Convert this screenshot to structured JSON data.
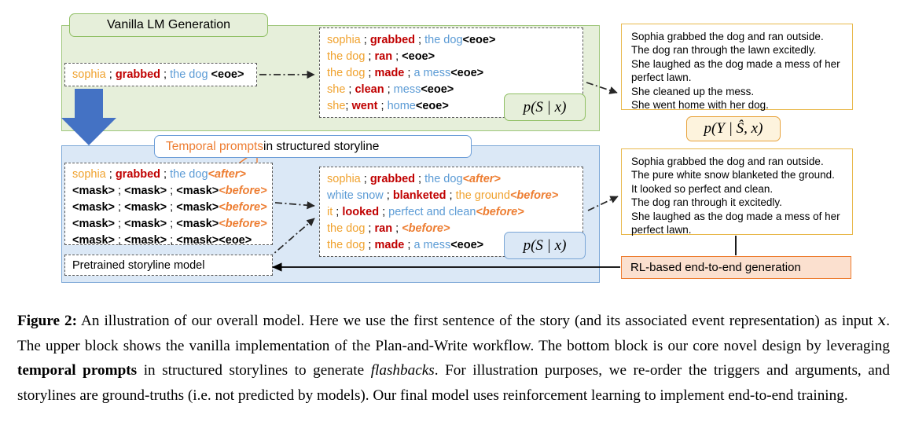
{
  "figure": {
    "vanilla_header": "Vanilla LM Generation",
    "temporal_header": {
      "accent": "Temporal prompts",
      "rest": " in structured storyline"
    },
    "input_box": [
      {
        "t": "sophia",
        "c": "ent"
      },
      {
        "t": " ; ",
        "c": "sep"
      },
      {
        "t": "grabbed",
        "c": "verb"
      },
      {
        "t": " ; ",
        "c": "sep"
      },
      {
        "t": "the dog",
        "c": "obj"
      },
      {
        "t": " <eoe>",
        "c": "tag"
      }
    ],
    "top_storyline": [
      [
        {
          "t": "sophia",
          "c": "ent"
        },
        {
          "t": " ; ",
          "c": "sep"
        },
        {
          "t": "grabbed",
          "c": "verb"
        },
        {
          "t": " ; ",
          "c": "sep"
        },
        {
          "t": "the dog",
          "c": "obj"
        },
        {
          "t": "<eoe>",
          "c": "tag"
        }
      ],
      [
        {
          "t": "the dog",
          "c": "ent"
        },
        {
          "t": " ; ",
          "c": "sep"
        },
        {
          "t": "ran",
          "c": "verb"
        },
        {
          "t": " ; ",
          "c": "sep"
        },
        {
          "t": "<eoe>",
          "c": "tag"
        }
      ],
      [
        {
          "t": "the dog",
          "c": "ent"
        },
        {
          "t": " ; ",
          "c": "sep"
        },
        {
          "t": "made",
          "c": "verb"
        },
        {
          "t": " ; ",
          "c": "sep"
        },
        {
          "t": "a mess",
          "c": "obj"
        },
        {
          "t": "<eoe>",
          "c": "tag"
        }
      ],
      [
        {
          "t": "she",
          "c": "ent"
        },
        {
          "t": " ; ",
          "c": "sep"
        },
        {
          "t": "clean",
          "c": "verb"
        },
        {
          "t": " ; ",
          "c": "sep"
        },
        {
          "t": "mess",
          "c": "obj"
        },
        {
          "t": "<eoe>",
          "c": "tag"
        }
      ],
      [
        {
          "t": "she",
          "c": "ent"
        },
        {
          "t": "; ",
          "c": "sep"
        },
        {
          "t": "went",
          "c": "verb"
        },
        {
          "t": " ; ",
          "c": "sep"
        },
        {
          "t": "home",
          "c": "obj"
        },
        {
          "t": "<eoe>",
          "c": "tag"
        }
      ]
    ],
    "mask_storyline": [
      [
        {
          "t": "sophia",
          "c": "ent"
        },
        {
          "t": " ; ",
          "c": "sep"
        },
        {
          "t": "grabbed",
          "c": "verb"
        },
        {
          "t": " ; ",
          "c": "sep"
        },
        {
          "t": "the dog",
          "c": "obj"
        },
        {
          "t": "<after>",
          "c": "temp"
        }
      ],
      [
        {
          "t": "<mask>",
          "c": "mask"
        },
        {
          "t": " ; ",
          "c": "sep"
        },
        {
          "t": "<mask>",
          "c": "mask"
        },
        {
          "t": " ; ",
          "c": "sep"
        },
        {
          "t": "<mask>",
          "c": "mask"
        },
        {
          "t": "<before>",
          "c": "temp"
        }
      ],
      [
        {
          "t": "<mask>",
          "c": "mask"
        },
        {
          "t": " ; ",
          "c": "sep"
        },
        {
          "t": "<mask>",
          "c": "mask"
        },
        {
          "t": " ; ",
          "c": "sep"
        },
        {
          "t": "<mask>",
          "c": "mask"
        },
        {
          "t": "<before>",
          "c": "temp"
        }
      ],
      [
        {
          "t": "<mask>",
          "c": "mask"
        },
        {
          "t": " ; ",
          "c": "sep"
        },
        {
          "t": "<mask>",
          "c": "mask"
        },
        {
          "t": " ; ",
          "c": "sep"
        },
        {
          "t": "<mask>",
          "c": "mask"
        },
        {
          "t": "<before>",
          "c": "temp"
        }
      ],
      [
        {
          "t": "<mask>",
          "c": "mask"
        },
        {
          "t": " ; ",
          "c": "sep"
        },
        {
          "t": "<mask>",
          "c": "mask"
        },
        {
          "t": " ; ",
          "c": "sep"
        },
        {
          "t": "<mask>",
          "c": "mask"
        },
        {
          "t": "<eoe>",
          "c": "tag"
        }
      ]
    ],
    "bottom_storyline": [
      [
        {
          "t": "sophia",
          "c": "ent"
        },
        {
          "t": " ; ",
          "c": "sep"
        },
        {
          "t": "grabbed",
          "c": "verb"
        },
        {
          "t": " ; ",
          "c": "sep"
        },
        {
          "t": "the dog",
          "c": "obj"
        },
        {
          "t": "<after>",
          "c": "temp"
        }
      ],
      [
        {
          "t": "white snow",
          "c": "obj"
        },
        {
          "t": " ; ",
          "c": "sep"
        },
        {
          "t": "blanketed",
          "c": "verb"
        },
        {
          "t": " ; ",
          "c": "sep"
        },
        {
          "t": "the ground",
          "c": "ent"
        },
        {
          "t": "<before>",
          "c": "temp"
        }
      ],
      [
        {
          "t": "it",
          "c": "ent"
        },
        {
          "t": " ; ",
          "c": "sep"
        },
        {
          "t": "looked",
          "c": "verb"
        },
        {
          "t": " ; ",
          "c": "sep"
        },
        {
          "t": "perfect and clean",
          "c": "obj"
        },
        {
          "t": "<before>",
          "c": "temp"
        }
      ],
      [
        {
          "t": "the dog",
          "c": "ent"
        },
        {
          "t": " ; ",
          "c": "sep"
        },
        {
          "t": "ran",
          "c": "verb"
        },
        {
          "t": " ; ",
          "c": "sep"
        },
        {
          "t": "<before>",
          "c": "temp"
        }
      ],
      [
        {
          "t": "the dog",
          "c": "ent"
        },
        {
          "t": " ; ",
          "c": "sep"
        },
        {
          "t": "made",
          "c": "verb"
        },
        {
          "t": " ; ",
          "c": "sep"
        },
        {
          "t": "a mess",
          "c": "obj"
        },
        {
          "t": "<eoe>",
          "c": "tag"
        }
      ]
    ],
    "pretrained_label": "Pretrained storyline model",
    "prob_top": "p(S | x)",
    "prob_bottom": "p(S | x)",
    "prob_mid": "p(Y | Ŝ, x)",
    "story_top": [
      "Sophia grabbed the dog and ran outside.",
      "The dog ran through the lawn excitedly.",
      "She laughed as the dog made a mess of her",
      "perfect lawn.",
      "She cleaned up the mess.",
      "She went home with her dog."
    ],
    "story_bottom": [
      "Sophia grabbed the dog and ran outside.",
      "The pure white snow blanketed the ground.",
      "It looked so perfect and clean.",
      "The dog ran through it excitedly.",
      "She laughed as the dog made a mess of her",
      "perfect lawn."
    ],
    "rl_banner": "RL-based end-to-end generation",
    "colors": {
      "entity": "#F0A22E",
      "verb": "#C00000",
      "object": "#5B9BD5",
      "temporal": "#ED7D31",
      "green_panel": "#e6efda",
      "green_border": "#9ec67b",
      "blue_panel": "#dbe8f6",
      "blue_border": "#7aa6d6",
      "story_border": "#E8B84B",
      "rl_fill": "#fbe0cf",
      "arrow_blue": "#4472C4"
    }
  },
  "caption": {
    "label": "Figure 2:",
    "text": " An illustration of our overall model. Here we use the first sentence of the story (and its associated event representation) as input x.  The upper block shows the vanilla implementation of the Plan-and-Write workflow. The bottom block is our core novel design by leveraging temporal prompts in structured storylines to generate flashbacks. For illustration purposes, we re-order the triggers and arguments, and storylines are ground-truths (i.e. not predicted by models). Our final model uses reinforcement learning to implement end-to-end training.",
    "bold_phrase": "temporal prompts",
    "italic_phrase": "flashbacks",
    "math_var": "x"
  }
}
